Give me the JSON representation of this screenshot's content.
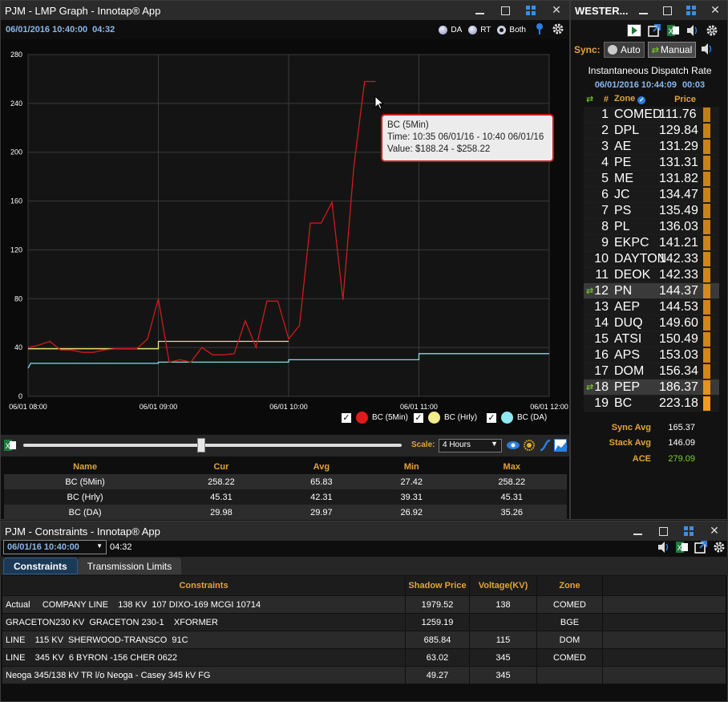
{
  "lmp": {
    "title": "PJM - LMP Graph - Innotap® App",
    "timestamp": "06/01/2016 10:40:00",
    "elapsed": "04:32",
    "radio_options": [
      "DA",
      "RT",
      "Both"
    ],
    "tooltip": {
      "title": "BC (5Min)",
      "time": "Time: 10:35 06/01/16 - 10:40 06/01/16",
      "value": "Value: $188.24 - $258.22"
    },
    "legend": [
      "BC (5Min)",
      "BC (Hrly)",
      "BC (DA)"
    ],
    "scale_label": "Scale:",
    "scale_value": "4 Hours",
    "slider_value": 0.5,
    "stats": {
      "headers": [
        "Name",
        "Cur",
        "Avg",
        "Min",
        "Max"
      ],
      "rows": [
        [
          "BC (5Min)",
          "258.22",
          "65.83",
          "27.42",
          "258.22"
        ],
        [
          "BC (Hrly)",
          "45.31",
          "42.31",
          "39.31",
          "45.31"
        ],
        [
          "BC (DA)",
          "29.98",
          "29.97",
          "26.92",
          "35.26"
        ]
      ]
    }
  },
  "chart_data": {
    "type": "line",
    "ylim": [
      0,
      280
    ],
    "yticks": [
      "0",
      "40",
      "80",
      "120",
      "160",
      "200",
      "240",
      "280"
    ],
    "xticks": [
      "06/01 08:00",
      "06/01 09:00",
      "06/01 10:00",
      "06/01 11:00",
      "06/01 12:00"
    ],
    "xlim_hours": [
      8,
      12
    ],
    "series": [
      {
        "name": "BC (5Min)",
        "color": "#d11a1a",
        "x": [
          8.0,
          8.083,
          8.167,
          8.25,
          8.333,
          8.417,
          8.5,
          8.583,
          8.667,
          8.75,
          8.833,
          8.917,
          9.0,
          9.083,
          9.167,
          9.25,
          9.333,
          9.417,
          9.5,
          9.583,
          9.667,
          9.75,
          9.833,
          9.917,
          10.0,
          10.083,
          10.167,
          10.25,
          10.333,
          10.417,
          10.5,
          10.583,
          10.667
        ],
        "values": [
          40,
          42,
          45,
          38,
          38,
          36,
          36,
          38,
          39,
          39,
          39,
          47,
          80,
          28,
          30,
          28,
          40,
          34,
          34,
          35,
          62,
          40,
          78,
          78,
          47,
          58,
          142,
          142,
          159,
          79,
          188,
          258,
          258
        ]
      },
      {
        "name": "BC (Hrly)",
        "color": "#e8e07a",
        "x": [
          8.0,
          9.0,
          9.0,
          10.0
        ],
        "values": [
          39,
          39,
          45,
          45
        ]
      },
      {
        "name": "BC (DA)",
        "color": "#7fdde8",
        "x": [
          8.0,
          8.02,
          9.0,
          9.0,
          10.0,
          10.0,
          11.0,
          11.0,
          12.0
        ],
        "values": [
          23,
          27,
          27,
          28,
          28,
          30,
          30,
          35,
          35
        ]
      }
    ]
  },
  "west": {
    "title": "WESTER...",
    "sync_label": "Sync:",
    "auto_label": "Auto",
    "manual_label": "Manual",
    "heading": "Instantaneous Dispatch Rate",
    "timestamp": "06/01/2016 10:44:09",
    "elapsed": "00:03",
    "col_num": "#",
    "col_zone": "Zone",
    "col_price": "Price",
    "rows": [
      {
        "num": "1",
        "zone": "COMED",
        "price": "111.76",
        "fill": 0.5
      },
      {
        "num": "2",
        "zone": "DPL",
        "price": "129.84",
        "fill": 0.58
      },
      {
        "num": "3",
        "zone": "AE",
        "price": "131.29",
        "fill": 0.59
      },
      {
        "num": "4",
        "zone": "PE",
        "price": "131.31",
        "fill": 0.59
      },
      {
        "num": "5",
        "zone": "ME",
        "price": "131.82",
        "fill": 0.59
      },
      {
        "num": "6",
        "zone": "JC",
        "price": "134.47",
        "fill": 0.6
      },
      {
        "num": "7",
        "zone": "PS",
        "price": "135.49",
        "fill": 0.61
      },
      {
        "num": "8",
        "zone": "PL",
        "price": "136.03",
        "fill": 0.61
      },
      {
        "num": "9",
        "zone": "EKPC",
        "price": "141.21",
        "fill": 0.63
      },
      {
        "num": "10",
        "zone": "DAYTON",
        "price": "142.33",
        "fill": 0.64
      },
      {
        "num": "11",
        "zone": "DEOK",
        "price": "142.33",
        "fill": 0.64
      },
      {
        "num": "12",
        "zone": "PN",
        "price": "144.37",
        "fill": 0.65,
        "hl": true
      },
      {
        "num": "13",
        "zone": "AEP",
        "price": "144.53",
        "fill": 0.65
      },
      {
        "num": "14",
        "zone": "DUQ",
        "price": "149.60",
        "fill": 0.67
      },
      {
        "num": "15",
        "zone": "ATSI",
        "price": "150.49",
        "fill": 0.67
      },
      {
        "num": "16",
        "zone": "APS",
        "price": "153.03",
        "fill": 0.69
      },
      {
        "num": "17",
        "zone": "DOM",
        "price": "156.34",
        "fill": 0.7
      },
      {
        "num": "18",
        "zone": "PEP",
        "price": "186.37",
        "fill": 0.84,
        "hl": true
      },
      {
        "num": "19",
        "zone": "BC",
        "price": "223.18",
        "fill": 1.0
      }
    ],
    "sync_avg_label": "Sync Avg",
    "sync_avg": "165.37",
    "stack_avg_label": "Stack Avg",
    "stack_avg": "146.09",
    "ace_label": "ACE",
    "ace": "279.09",
    "ace_color": "#7ed321"
  },
  "cons": {
    "title": "PJM - Constraints - Innotap® App",
    "date_value": "06/01/16 10:40:00",
    "elapsed": "04:32",
    "tabs": [
      "Constraints",
      "Transmission Limits"
    ],
    "headers": [
      "Constraints",
      "Shadow Price",
      "Voltage(KV)",
      "Zone",
      ""
    ],
    "rows": [
      [
        "Actual     COMPANY LINE    138 KV  107 DIXO-169 MCGI 10714",
        "1979.52",
        "138",
        "COMED",
        ""
      ],
      [
        "GRACETON230 KV  GRACETON 230-1    XFORMER",
        "1259.19",
        "",
        "BGE",
        ""
      ],
      [
        "LINE    115 KV  SHERWOOD-TRANSCO  91C",
        "685.84",
        "115",
        "DOM",
        ""
      ],
      [
        "LINE    345 KV  6 BYRON -156 CHER 0622",
        "63.02",
        "345",
        "COMED",
        ""
      ],
      [
        "Neoga 345/138 kV TR l/o Neoga - Casey 345 kV FG",
        "49.27",
        "345",
        "",
        ""
      ]
    ]
  }
}
